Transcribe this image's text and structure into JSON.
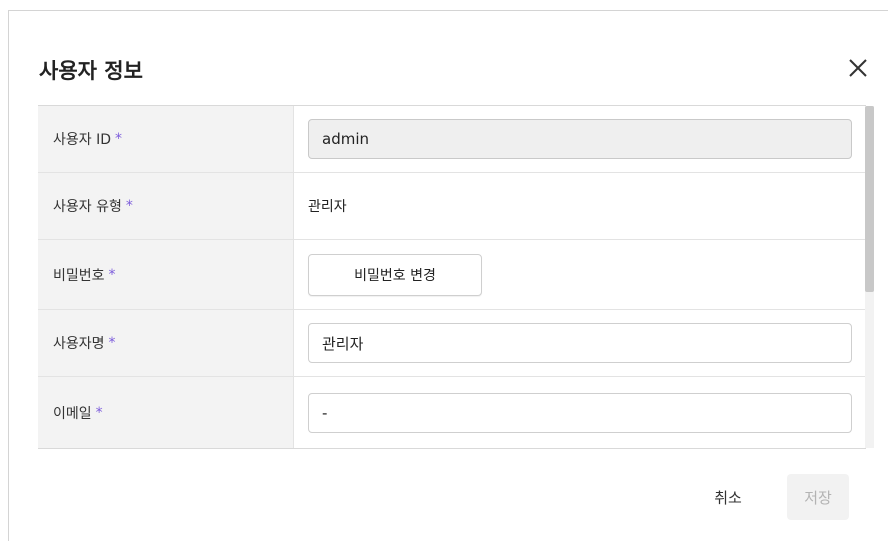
{
  "dialog": {
    "title": "사용자 정보",
    "close_icon": "close-icon",
    "required_mark": "*"
  },
  "form": {
    "user_id": {
      "label": "사용자 ID",
      "value": "admin",
      "disabled": true
    },
    "user_type": {
      "label": "사용자 유형",
      "value": "관리자"
    },
    "password": {
      "label": "비밀번호",
      "button_label": "비밀번호 변경"
    },
    "user_name": {
      "label": "사용자명",
      "value": "관리자"
    },
    "email": {
      "label": "이메일",
      "value": "-"
    }
  },
  "footer": {
    "cancel_label": "취소",
    "save_label": "저장"
  },
  "colors": {
    "required": "#7c5cdb",
    "label_bg": "#f3f3f3",
    "disabled_input_bg": "#efefef",
    "save_disabled_text": "#b3b3b3"
  }
}
